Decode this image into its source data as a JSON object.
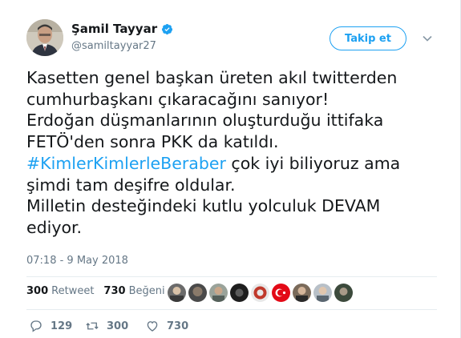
{
  "header": {
    "display_name": "Şamil Tayyar",
    "handle": "@samiltayyar27",
    "follow_label": "Takip et"
  },
  "tweet": {
    "lines": [
      "Kasetten genel başkan üreten akıl twitterden",
      "cumhurbaşkanı çıkaracağını sanıyor!",
      "Erdoğan düşmanlarının oluşturduğu ittifaka",
      "FETÖ'den sonra PKK da katıldı."
    ],
    "hashtag": "#KimlerKimlerleBeraber",
    "hashtag_tail": " çok iyi biliyoruz ama",
    "lines_after": [
      "şimdi tam deşifre oldular.",
      "Milletin desteğindeki kutlu yolculuk DEVAM",
      "ediyor."
    ],
    "timestamp": "07:18 - 9 May 2018"
  },
  "stats": {
    "retweet_count": "300",
    "retweet_label": "Retweet",
    "like_count": "730",
    "like_label": "Beğeni"
  },
  "actions": {
    "reply_count": "129",
    "retweet_count": "300",
    "like_count": "730"
  },
  "colors": {
    "accent": "#1da1f2",
    "text": "#14171a",
    "muted": "#657786"
  },
  "icons": [
    "verified-icon",
    "chevron-down-icon",
    "reply-icon",
    "retweet-icon",
    "heart-icon"
  ]
}
